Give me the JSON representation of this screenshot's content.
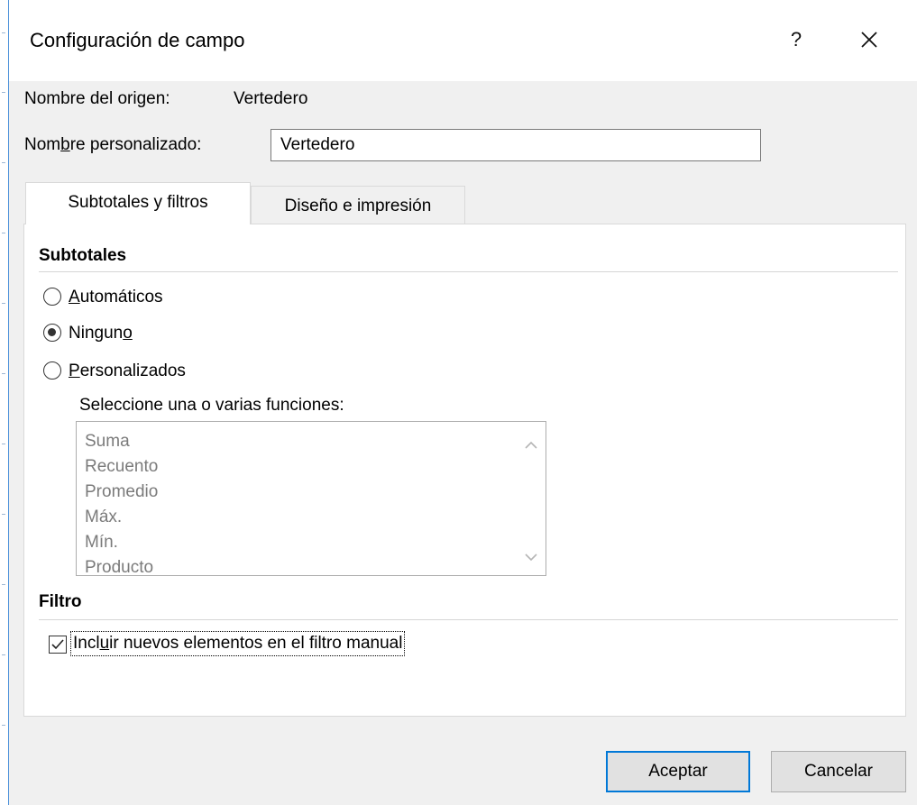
{
  "dialog": {
    "title": "Configuración de campo",
    "help_glyph": "?",
    "source_name_label": "Nombre del origen:",
    "source_name_value": "Vertedero",
    "custom_name_label_pre": "Nom",
    "custom_name_label_mnemonic": "b",
    "custom_name_label_post": "re personalizado:",
    "custom_name_value": "Vertedero"
  },
  "tabs": [
    {
      "label": "Subtotales y filtros",
      "active": true
    },
    {
      "label": "Diseño e impresión",
      "active": false
    }
  ],
  "subtotals": {
    "heading": "Subtotales",
    "options": [
      {
        "mnemonic": "A",
        "rest": "utomáticos",
        "pre": "",
        "selected": false
      },
      {
        "pre": "Ningun",
        "mnemonic": "o",
        "rest": "",
        "selected": true
      },
      {
        "pre": "",
        "mnemonic": "P",
        "rest": "ersonalizados",
        "selected": false
      }
    ],
    "functions_label": "Seleccione una o varias funciones:",
    "functions": [
      "Suma",
      "Recuento",
      "Promedio",
      "Máx.",
      "Mín.",
      "Producto"
    ]
  },
  "filter": {
    "heading": "Filtro",
    "include_pre": "Incl",
    "include_mnemonic": "u",
    "include_post": "ir nuevos elementos en el filtro manual",
    "include_checked": true
  },
  "buttons": {
    "ok_label": "Aceptar",
    "cancel_label": "Cancelar"
  },
  "colors": {
    "accent": "#0078d7",
    "dialog_bg": "#f0f0f0",
    "disabled_text": "#7b7b7b"
  },
  "icons": {
    "close": "close-icon",
    "scroll_up": "chevron-up-icon",
    "scroll_down": "chevron-down-icon",
    "check": "checkmark-icon"
  }
}
